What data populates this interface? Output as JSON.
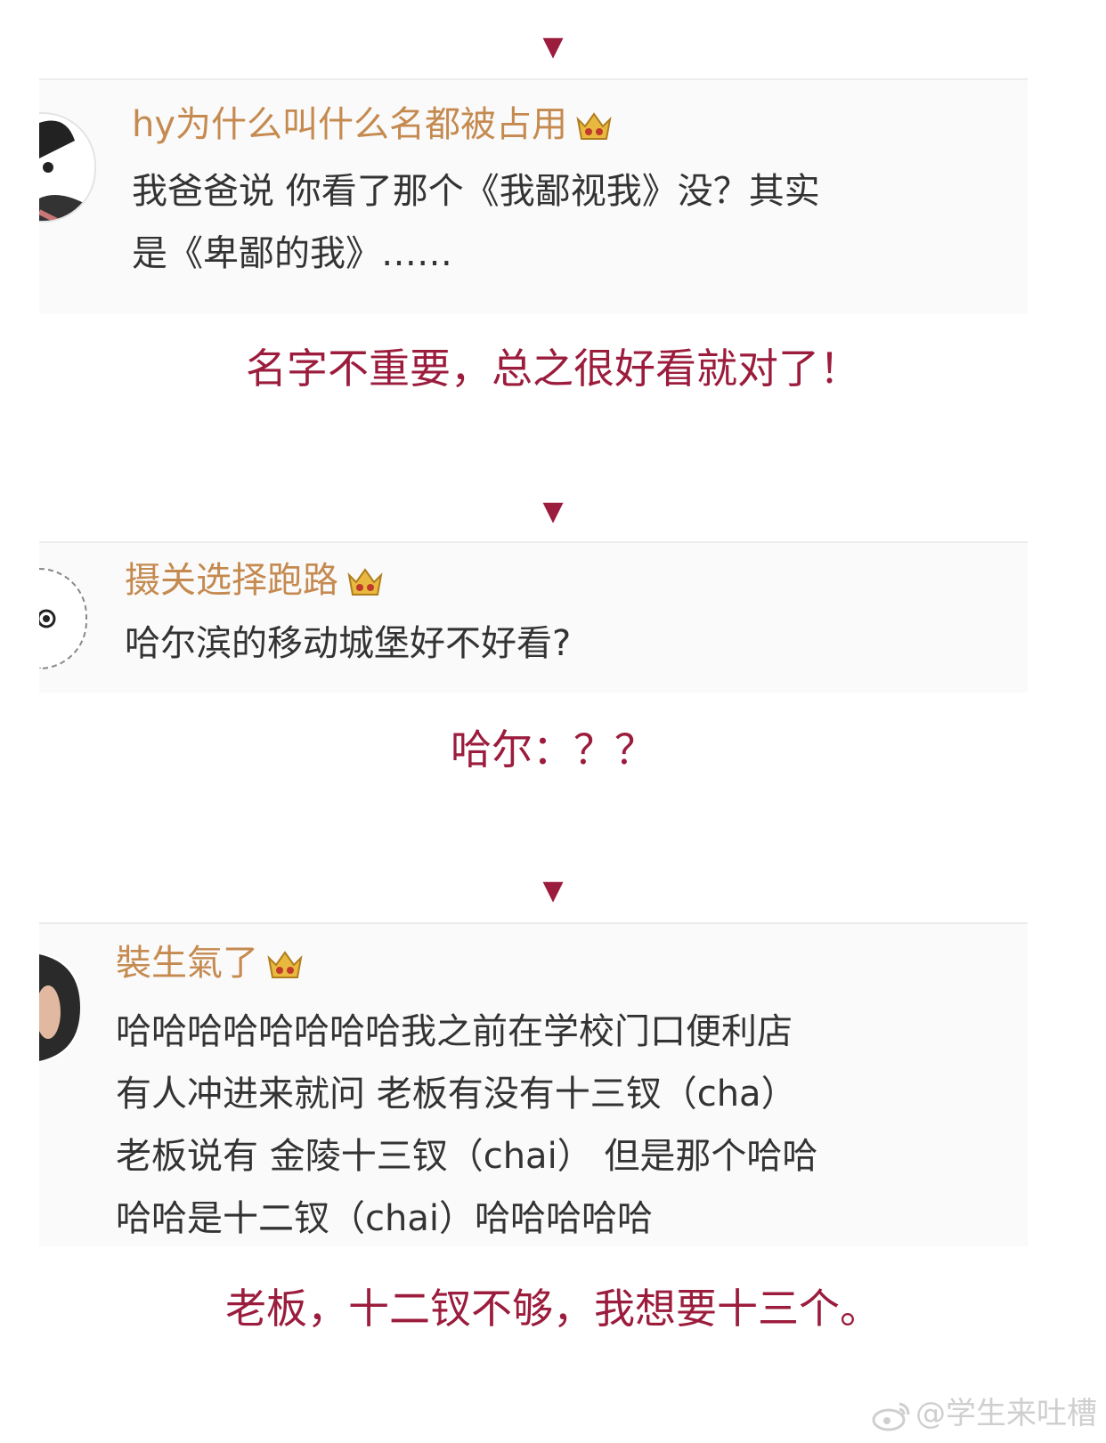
{
  "colors": {
    "accent": "#9b1c3c",
    "username": "#c58a50",
    "text": "#333333",
    "watermark": "#cfcfcf"
  },
  "arrow_glyph": "▼",
  "posts": [
    {
      "username": "hy为什么叫什么名都被占用",
      "badge_icon": "crown-badge-icon",
      "lines": [
        "我爸爸说 你看了那个《我鄙视我》没？其实",
        "是《卑鄙的我》……"
      ],
      "caption": "名字不重要，总之很好看就对了！"
    },
    {
      "username": "摄关选择跑路",
      "badge_icon": "crown-badge-icon",
      "lines": [
        "哈尔滨的移动城堡好不好看?"
      ],
      "caption": "哈尔：？？"
    },
    {
      "username": "裝生氣了",
      "badge_icon": "crown-badge-icon",
      "lines": [
        "哈哈哈哈哈哈哈哈我之前在学校门口便利店",
        "有人冲进来就问 老板有没有十三钗（cha）",
        "老板说有 金陵十三钗（chai） 但是那个哈哈",
        "哈哈是十二钗（chai）哈哈哈哈哈"
      ],
      "caption": "老板，十二钗不够，我想要十三个。"
    }
  ],
  "watermark": {
    "icon": "weibo-icon",
    "text": "@学生来吐槽"
  }
}
